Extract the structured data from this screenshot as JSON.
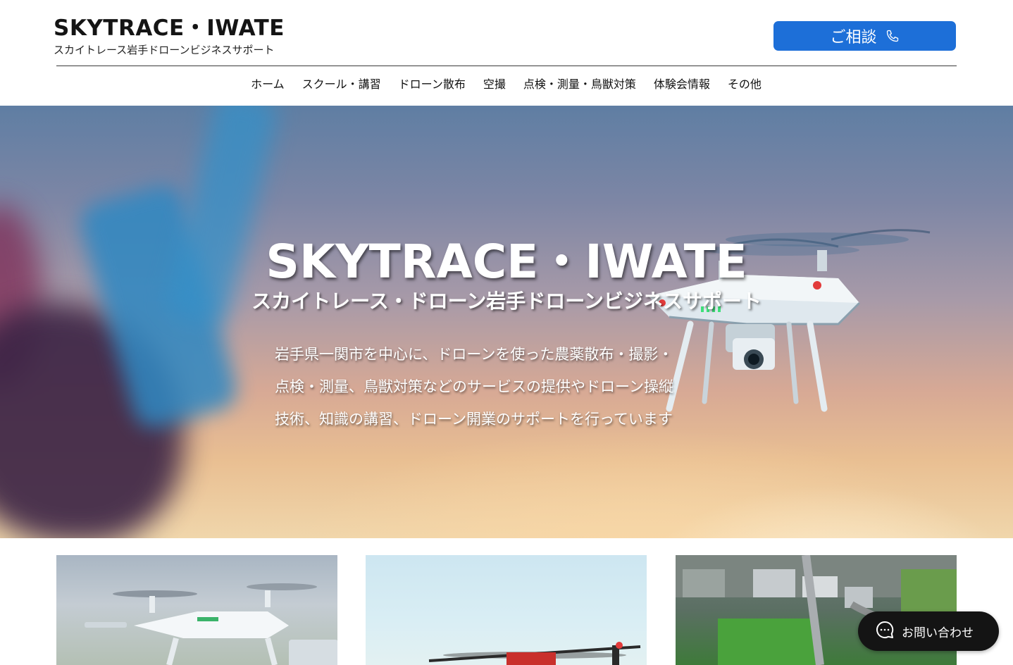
{
  "header": {
    "logo_title": "SKYTRACE・IWATE",
    "logo_subtitle": "スカイトレース岩手ドローンビジネスサポート",
    "consult_label": "ご相談"
  },
  "nav": {
    "items": [
      {
        "label": "ホーム"
      },
      {
        "label": "スクール・講習"
      },
      {
        "label": "ドローン散布"
      },
      {
        "label": "空撮"
      },
      {
        "label": "点検・測量・鳥獣対策"
      },
      {
        "label": "体験会情報"
      },
      {
        "label": "その他"
      }
    ]
  },
  "hero": {
    "title": "SKYTRACE・IWATE",
    "subtitle": "スカイトレース・ドローン岩手ドローンビジネスサポート",
    "description_lines": [
      "岩手県一関市を中心に、ドローンを使った農薬散布・撮影・",
      "点検・測量、鳥獣対策などのサービスの提供やドローン操縦",
      "技術、知識の講習、ドローン開業のサポートを行っています"
    ]
  },
  "chat": {
    "label": "お問い合わせ"
  },
  "colors": {
    "accent": "#1d6fd8",
    "chat_bg": "#141414"
  },
  "icons": {
    "consult": "phone-icon",
    "chat": "chat-bubble-icon"
  }
}
